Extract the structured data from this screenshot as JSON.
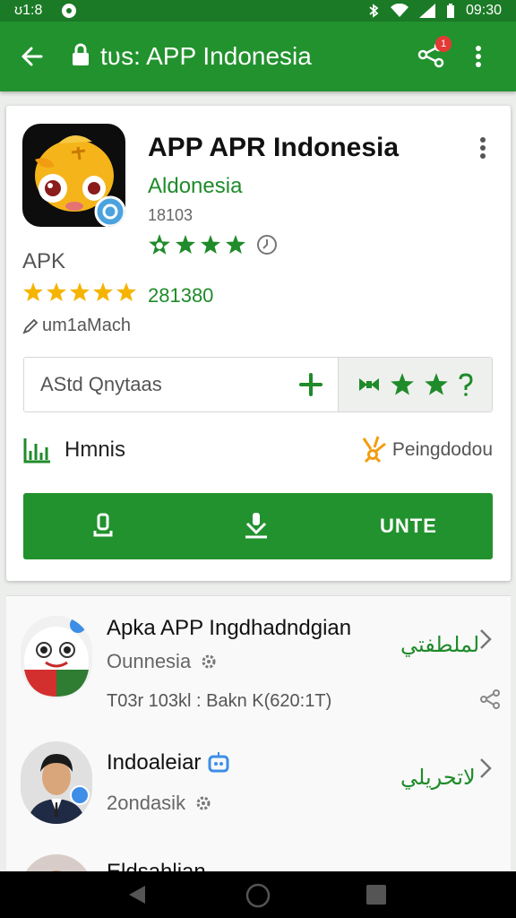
{
  "status_bar": {
    "time_left": "ʊ1:8",
    "time_right": "09:30"
  },
  "app_bar": {
    "title": "tʋs: APP Indonesia",
    "notification_count": "1"
  },
  "app": {
    "title": "APP APR Indonesia",
    "developer": "Aldonesia",
    "size": "18103",
    "label": "APK",
    "rating_count": "281380",
    "uploader": "um1aMach"
  },
  "actions": {
    "left_label": "AStd Qnytaas"
  },
  "meta": {
    "left_label": "Hmnis",
    "right_label": "Peingdodou"
  },
  "install_button": {
    "label": "UNTE"
  },
  "list": [
    {
      "title": "Apka APP Ingdhadndgian",
      "subtitle": "Ounnesia",
      "meta": "T03r 103kl : Bakn K(620:1T)",
      "arabic": "لملطفتي"
    },
    {
      "title": "Indoaleiar",
      "subtitle": "2ondasik",
      "arabic": "لاتحريلي"
    },
    {
      "title": "Eldsahlian"
    }
  ],
  "colors": {
    "primary": "#22922e",
    "status_bar": "#1b7a26",
    "accent_green": "#1f8b2a",
    "star_yellow": "#f5b400"
  }
}
